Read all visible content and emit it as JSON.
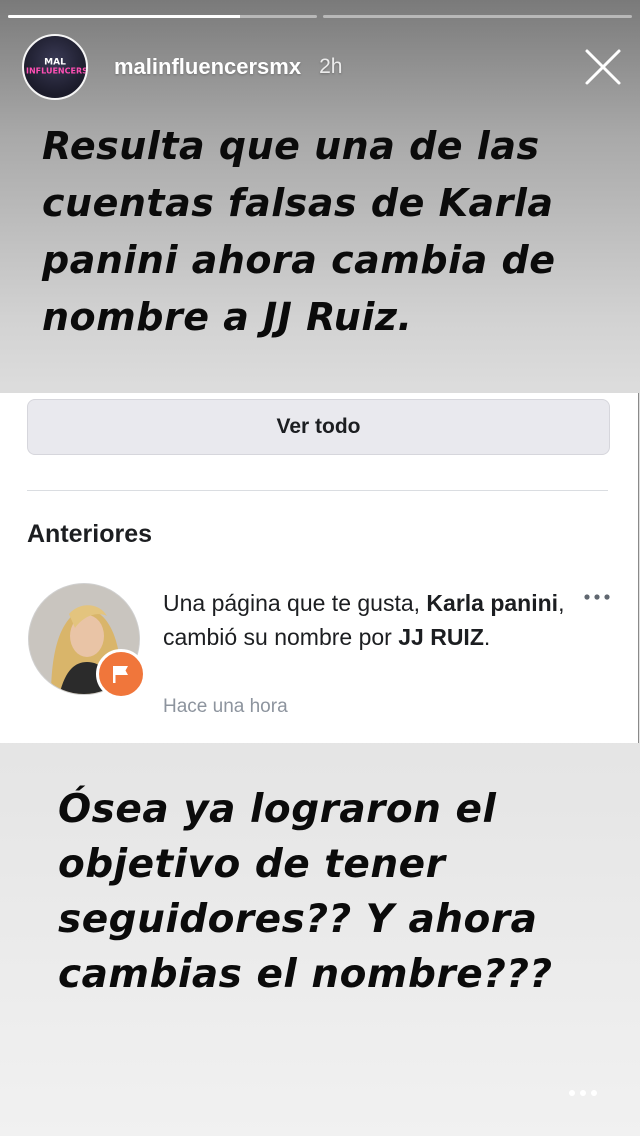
{
  "story": {
    "progress": [
      0.75,
      0.0
    ],
    "username": "malinfluencersmx",
    "time": "2h",
    "avatar_text": [
      "MAL",
      "INFLUENCERS"
    ],
    "caption_top": "Resulta que una de las cuentas falsas de Karla panini ahora cambia de nombre a JJ Ruiz.",
    "caption_bottom": "Ósea ya lograron el objetivo de tener seguidores?? Y ahora cambias el nombre???"
  },
  "screenshot": {
    "see_all": "Ver todo",
    "section_title": "Anteriores",
    "notification": {
      "prefix": "Una página que te gusta, ",
      "page_name": "Karla panini",
      "middle": ", cambió su nombre por ",
      "new_name": "JJ RUIZ",
      "suffix": ".",
      "time": "Hace una hora"
    }
  },
  "colors": {
    "badge": "#f0763b",
    "accent_pink": "#ff4fb4"
  },
  "icons": {
    "close": "close-icon",
    "more": "more-horizontal-icon",
    "flag": "flag-icon"
  }
}
